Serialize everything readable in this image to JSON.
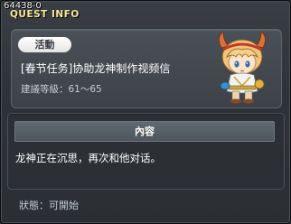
{
  "window": {
    "quest_id": "64438-0",
    "title": "QUEST INFO"
  },
  "quest": {
    "category": "活動",
    "name": "[春节任务]协助龙神制作视频信",
    "level_label": "建議等級",
    "level_separator": "：",
    "level_range": "61～65",
    "npc_icon": "npc-portrait-icon"
  },
  "content": {
    "header": "內容",
    "text": "龙神正在沉思，再次和他对话。"
  },
  "status": {
    "label": "狀態",
    "separator": "：",
    "value": "可開始"
  },
  "colors": {
    "title": "#f7e79a",
    "panel": "#3d4248",
    "text": "#ffffff",
    "muted": "#c4ccd4"
  }
}
